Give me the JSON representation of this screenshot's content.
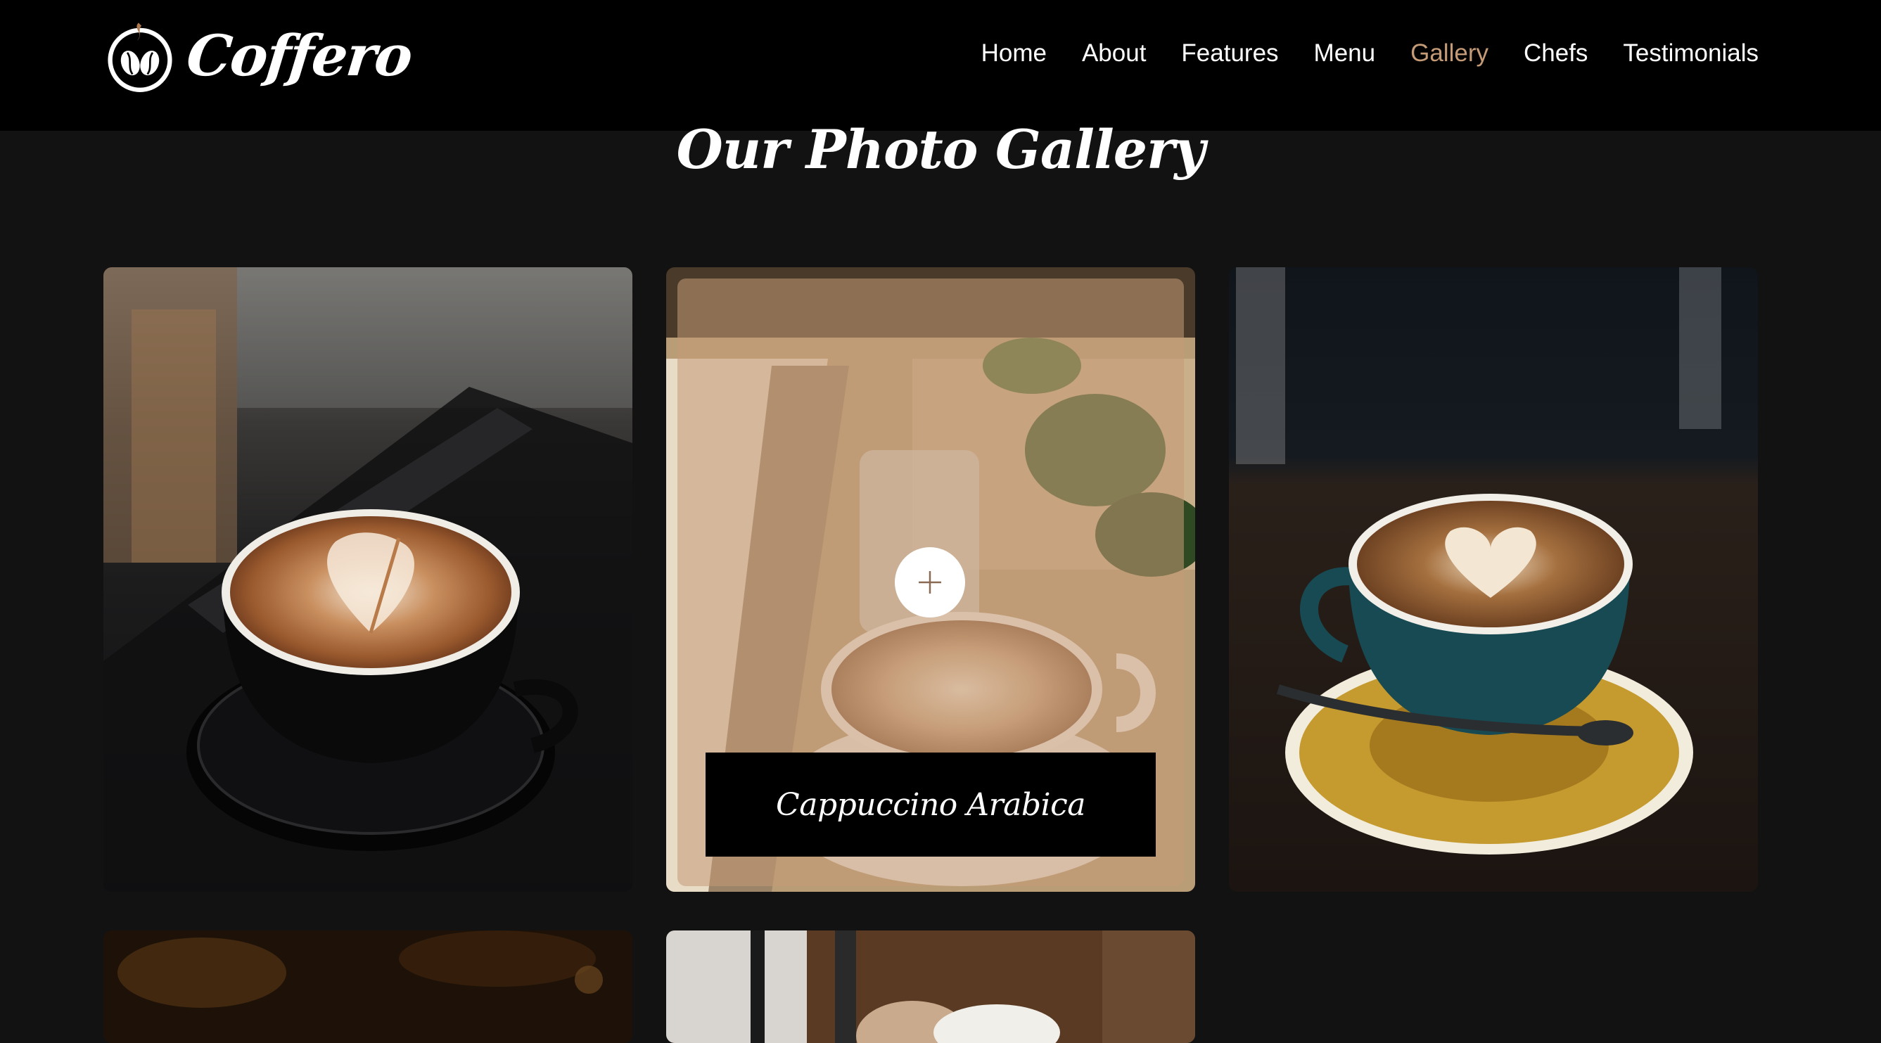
{
  "brand": {
    "name": "Coffero",
    "logo_icon": "coffee-bean-cup-icon"
  },
  "nav": {
    "items": [
      {
        "label": "Home"
      },
      {
        "label": "About"
      },
      {
        "label": "Features"
      },
      {
        "label": "Menu"
      },
      {
        "label": "Gallery",
        "active": true
      },
      {
        "label": "Chefs"
      },
      {
        "label": "Testimonials"
      }
    ]
  },
  "colors": {
    "background": "#121212",
    "header": "#000000",
    "accent": "#c49b76",
    "text": "#ffffff"
  },
  "gallery": {
    "title": "Our Photo Gallery",
    "items": [
      {
        "image": "latte art in black cup on dark saucer"
      },
      {
        "image": "cappuccino with plant and glass",
        "caption": "Cappuccino Arabica",
        "zoom_icon": "plus-icon",
        "hovered": true
      },
      {
        "image": "latte art in teal cup on yellow saucer"
      },
      {
        "image": "coffee photo (partially visible)"
      },
      {
        "image": "dessert photo (partially visible)"
      }
    ]
  }
}
